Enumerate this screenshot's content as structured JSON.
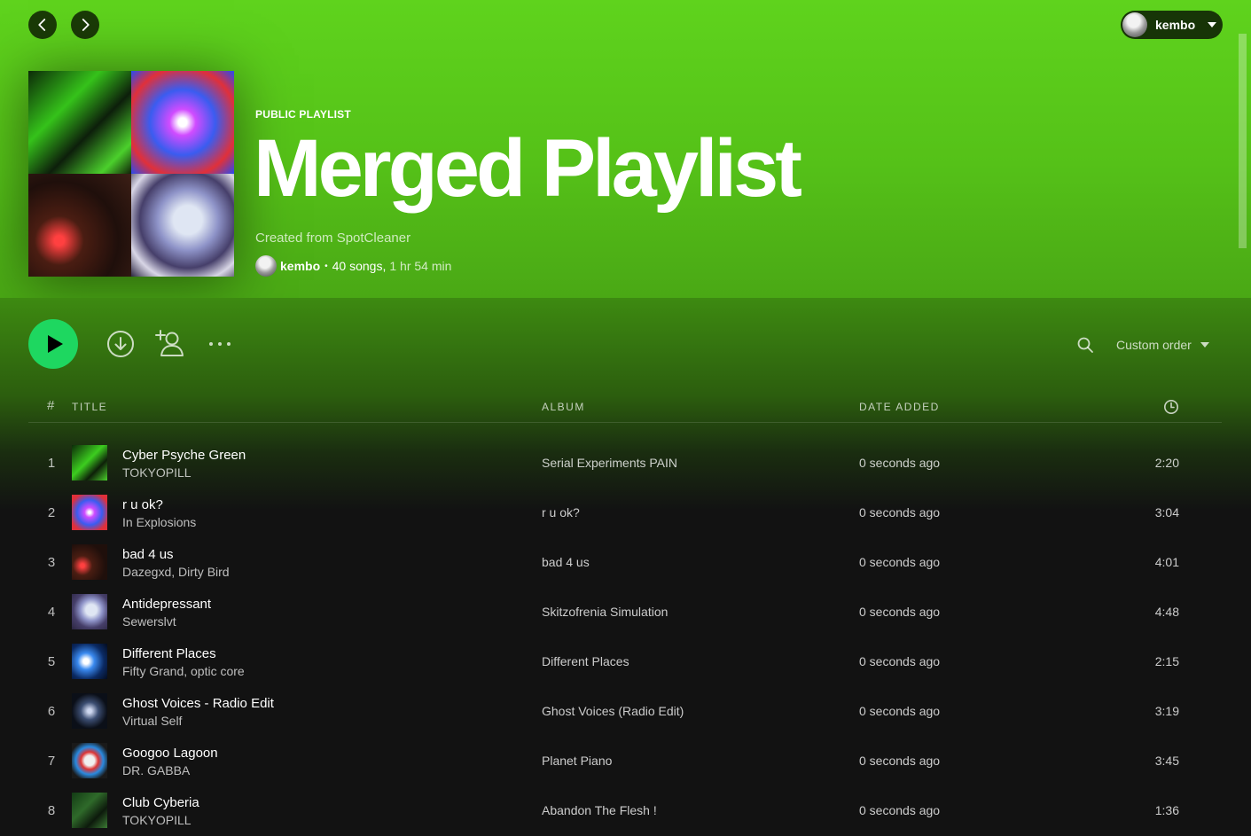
{
  "user": {
    "name": "kembo"
  },
  "playlist": {
    "type_label": "PUBLIC PLAYLIST",
    "title": "Merged Playlist",
    "description": "Created from SpotCleaner",
    "owner": "kembo",
    "song_count": "40 songs,",
    "duration": "1 hr 54 min"
  },
  "controls": {
    "sort_label": "Custom order"
  },
  "table": {
    "headers": {
      "num": "#",
      "title": "TITLE",
      "album": "ALBUM",
      "date_added": "DATE ADDED"
    },
    "rows": [
      {
        "num": "1",
        "title": "Cyber Psyche Green",
        "artist": "TOKYOPILL",
        "album": "Serial Experiments PAIN",
        "date_added": "0 seconds ago",
        "duration": "2:20"
      },
      {
        "num": "2",
        "title": "r u ok?",
        "artist": "In Explosions",
        "album": "r u ok?",
        "date_added": "0 seconds ago",
        "duration": "3:04"
      },
      {
        "num": "3",
        "title": "bad 4 us",
        "artist": "Dazegxd, Dirty Bird",
        "album": "bad 4 us",
        "date_added": "0 seconds ago",
        "duration": "4:01"
      },
      {
        "num": "4",
        "title": "Antidepressant",
        "artist": "Sewerslvt",
        "album": "Skitzofrenia Simulation",
        "date_added": "0 seconds ago",
        "duration": "4:48"
      },
      {
        "num": "5",
        "title": "Different Places",
        "artist": "Fifty Grand, optic core",
        "album": "Different Places",
        "date_added": "0 seconds ago",
        "duration": "2:15"
      },
      {
        "num": "6",
        "title": "Ghost Voices - Radio Edit",
        "artist": "Virtual Self",
        "album": "Ghost Voices (Radio Edit)",
        "date_added": "0 seconds ago",
        "duration": "3:19"
      },
      {
        "num": "7",
        "title": "Googoo Lagoon",
        "artist": "DR. GABBA",
        "album": "Planet Piano",
        "date_added": "0 seconds ago",
        "duration": "3:45"
      },
      {
        "num": "8",
        "title": "Club Cyberia",
        "artist": "TOKYOPILL",
        "album": "Abandon The Flesh !",
        "date_added": "0 seconds ago",
        "duration": "1:36"
      }
    ]
  },
  "colors": {
    "hero_green": "#5fd31d",
    "play_green": "#1ed760",
    "background": "#121212"
  }
}
